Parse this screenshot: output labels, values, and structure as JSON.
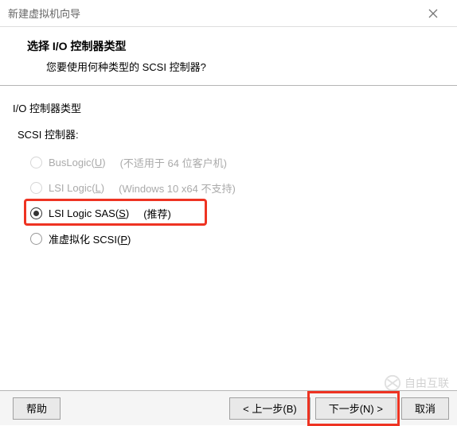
{
  "window": {
    "title": "新建虚拟机向导"
  },
  "header": {
    "title": "选择 I/O 控制器类型",
    "subtitle": "您要使用何种类型的 SCSI 控制器?"
  },
  "section": {
    "group_label": "I/O 控制器类型",
    "scsi_label": "SCSI 控制器:"
  },
  "options": [
    {
      "label": "BusLogic",
      "hotkey": "U",
      "note": "(不适用于 64 位客户机)",
      "enabled": false,
      "selected": false
    },
    {
      "label": "LSI Logic",
      "hotkey": "L",
      "note": "(Windows 10 x64 不支持)",
      "enabled": false,
      "selected": false
    },
    {
      "label": "LSI Logic SAS",
      "hotkey": "S",
      "note": "(推荐)",
      "enabled": true,
      "selected": true
    },
    {
      "label": "准虚拟化 SCSI",
      "hotkey": "P",
      "note": "",
      "enabled": true,
      "selected": false
    }
  ],
  "buttons": {
    "help": "帮助",
    "back": "< 上一步(B)",
    "next": "下一步(N) >",
    "cancel": "取消"
  },
  "watermark": "自由互联"
}
